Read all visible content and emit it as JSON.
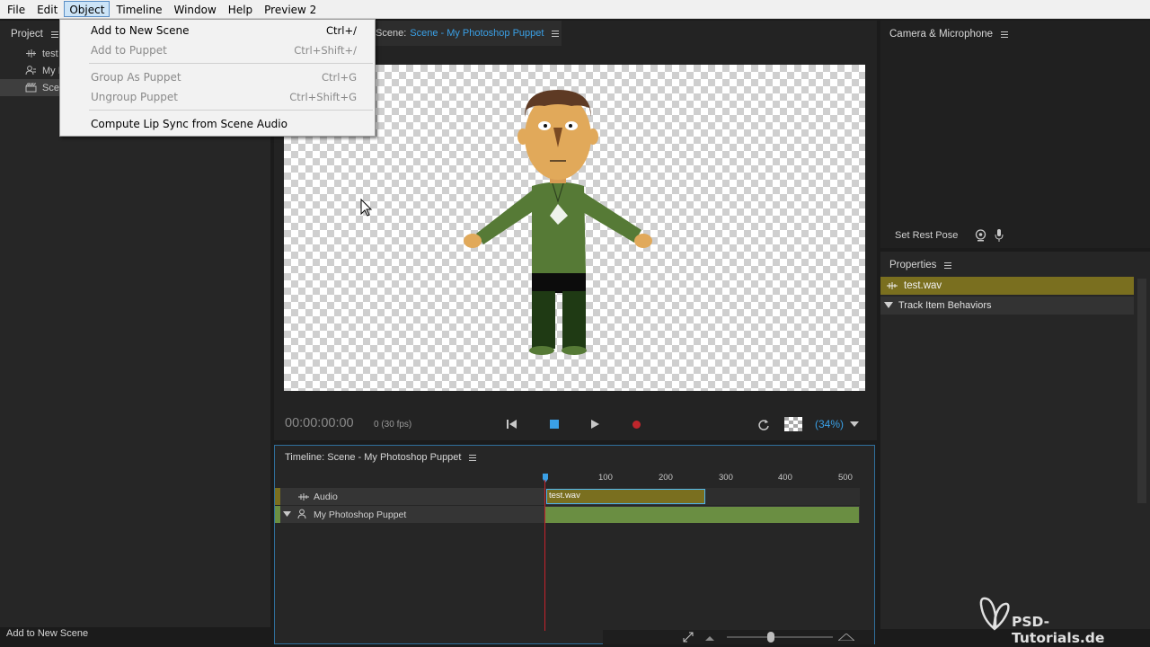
{
  "menubar": {
    "items": [
      "File",
      "Edit",
      "Object",
      "Timeline",
      "Window",
      "Help",
      "Preview 2"
    ],
    "active": "Object"
  },
  "object_menu": {
    "items": [
      {
        "label": "Add to New Scene",
        "shortcut": "Ctrl+/",
        "enabled": true
      },
      {
        "label": "Add to Puppet",
        "shortcut": "Ctrl+Shift+/",
        "enabled": false
      },
      {
        "label": "Group As Puppet",
        "shortcut": "Ctrl+G",
        "enabled": false
      },
      {
        "label": "Ungroup Puppet",
        "shortcut": "Ctrl+Shift+G",
        "enabled": false
      },
      {
        "label": "Compute Lip Sync from Scene Audio",
        "shortcut": "",
        "enabled": true
      }
    ]
  },
  "project": {
    "title": "Project",
    "items": [
      {
        "label": "test",
        "icon": "audio-icon"
      },
      {
        "label": "My I",
        "icon": "puppet-icon"
      },
      {
        "label": "Sce",
        "icon": "scene-icon",
        "selected": true
      }
    ]
  },
  "scene": {
    "tab_prefix": "Scene:",
    "tab_name": "Scene - My Photoshop Puppet",
    "timecode": "00:00:00:00",
    "frame_info": "0 (30 fps)",
    "zoom": "(34%)"
  },
  "camera": {
    "title": "Camera & Microphone",
    "set_rest_pose": "Set Rest Pose"
  },
  "properties": {
    "title": "Properties",
    "item": "test.wav",
    "section": "Track Item Behaviors"
  },
  "timeline": {
    "title": "Timeline: Scene - My Photoshop Puppet",
    "ruler": [
      "100",
      "200",
      "300",
      "400",
      "500"
    ],
    "tracks": [
      {
        "label": "Audio",
        "icon": "audio-icon"
      },
      {
        "label": "My Photoshop Puppet",
        "icon": "puppet-icon"
      }
    ],
    "audio_clip": "test.wav"
  },
  "status": {
    "text": "Add to New Scene"
  },
  "watermark": {
    "text": "PSD-Tutorials.de"
  },
  "colors": {
    "accent": "#3aa0e6",
    "audio_track": "#7a6f1f",
    "puppet_track": "#6a8e42",
    "playhead": "#c8232c",
    "record": "#c0262c"
  }
}
